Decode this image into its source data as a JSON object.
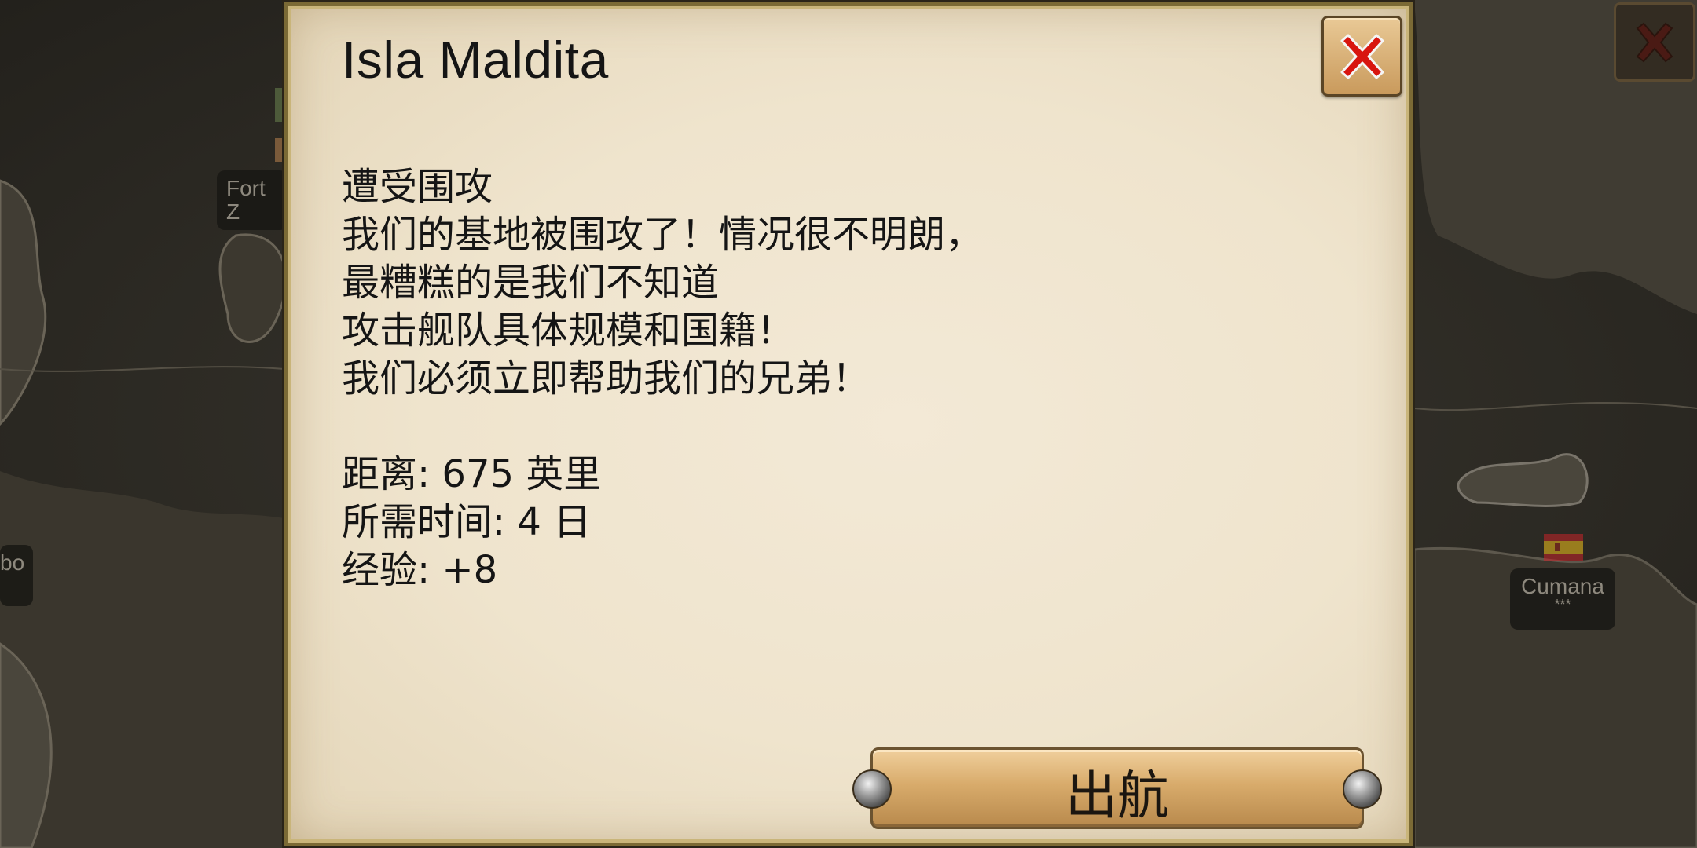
{
  "map": {
    "labels": {
      "fort": {
        "name": "Fort Z"
      },
      "left_edge": {
        "name": "bo"
      },
      "cumana": {
        "name": "Cumana",
        "stars": "***",
        "flag": "spain-flag"
      }
    },
    "close_icon": "close-icon"
  },
  "dialog": {
    "title": "Isla Maldita",
    "close_icon": "red-x-close-icon",
    "heading": "遭受围攻",
    "message_lines": [
      "我们的基地被围攻了！情况很不明朗，",
      "最糟糕的是我们不知道",
      "攻击舰队具体规模和国籍！",
      "我们必须立即帮助我们的兄弟！"
    ],
    "distance": "距离:  675 英里",
    "time_required": "所需时间:  4 日",
    "experience": "经验: +8",
    "set_sail_label": "出航"
  },
  "colors": {
    "parchment": "#efe4cd",
    "frame_gold": "#7b6a35",
    "button_bronze": "#d8ab6b",
    "close_red": "#d8150f",
    "map_dark": "#2e2b25"
  }
}
